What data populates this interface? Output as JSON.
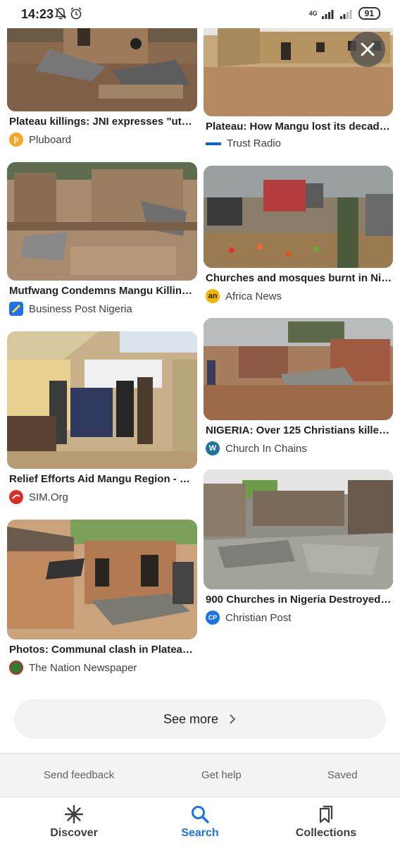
{
  "status_bar": {
    "time": "14:23",
    "network_label": "4G",
    "battery": "91"
  },
  "results": [
    {
      "title": "Plateau killings: JNI expresses \"utm...",
      "source": "Pluboard",
      "icon_letter": "þ",
      "icon_color": "#f5a623"
    },
    {
      "title": "Plateau: How Mangu lost its decade...",
      "source": "Trust Radio",
      "icon_letter": "",
      "icon_color": "#ffffff"
    },
    {
      "title": "Mutfwang Condemns Mangu Killing...",
      "source": "Business Post Nigeria",
      "icon_letter": "",
      "icon_color": "#1a73e8"
    },
    {
      "title": "Churches and mosques burnt in Nig...",
      "source": "Africa News",
      "icon_letter": "an",
      "icon_color": "#f4b400"
    },
    {
      "title": "Relief Efforts Aid Mangu Region - SI...",
      "source": "SIM.Org",
      "icon_letter": "",
      "icon_color": "#d93025"
    },
    {
      "title": "NIGERIA: Over 125 Christians killed i...",
      "source": "Church In Chains",
      "icon_letter": "W",
      "icon_color": "#21759b"
    },
    {
      "title": "Photos: Communal clash in Plateau ...",
      "source": "The Nation Newspaper",
      "icon_letter": "",
      "icon_color": "#2e7d32"
    },
    {
      "title": "900 Churches in Nigeria Destroyed ...",
      "source": "Christian Post",
      "icon_letter": "CP",
      "icon_color": "#1a73e8"
    }
  ],
  "see_more_label": "See more",
  "footer": {
    "send_feedback": "Send feedback",
    "get_help": "Get help",
    "saved": "Saved"
  },
  "bottom_nav": {
    "discover": "Discover",
    "search": "Search",
    "collections": "Collections"
  },
  "colors": {
    "accent": "#1a73e8",
    "pill_bg": "#f1f3f4"
  }
}
